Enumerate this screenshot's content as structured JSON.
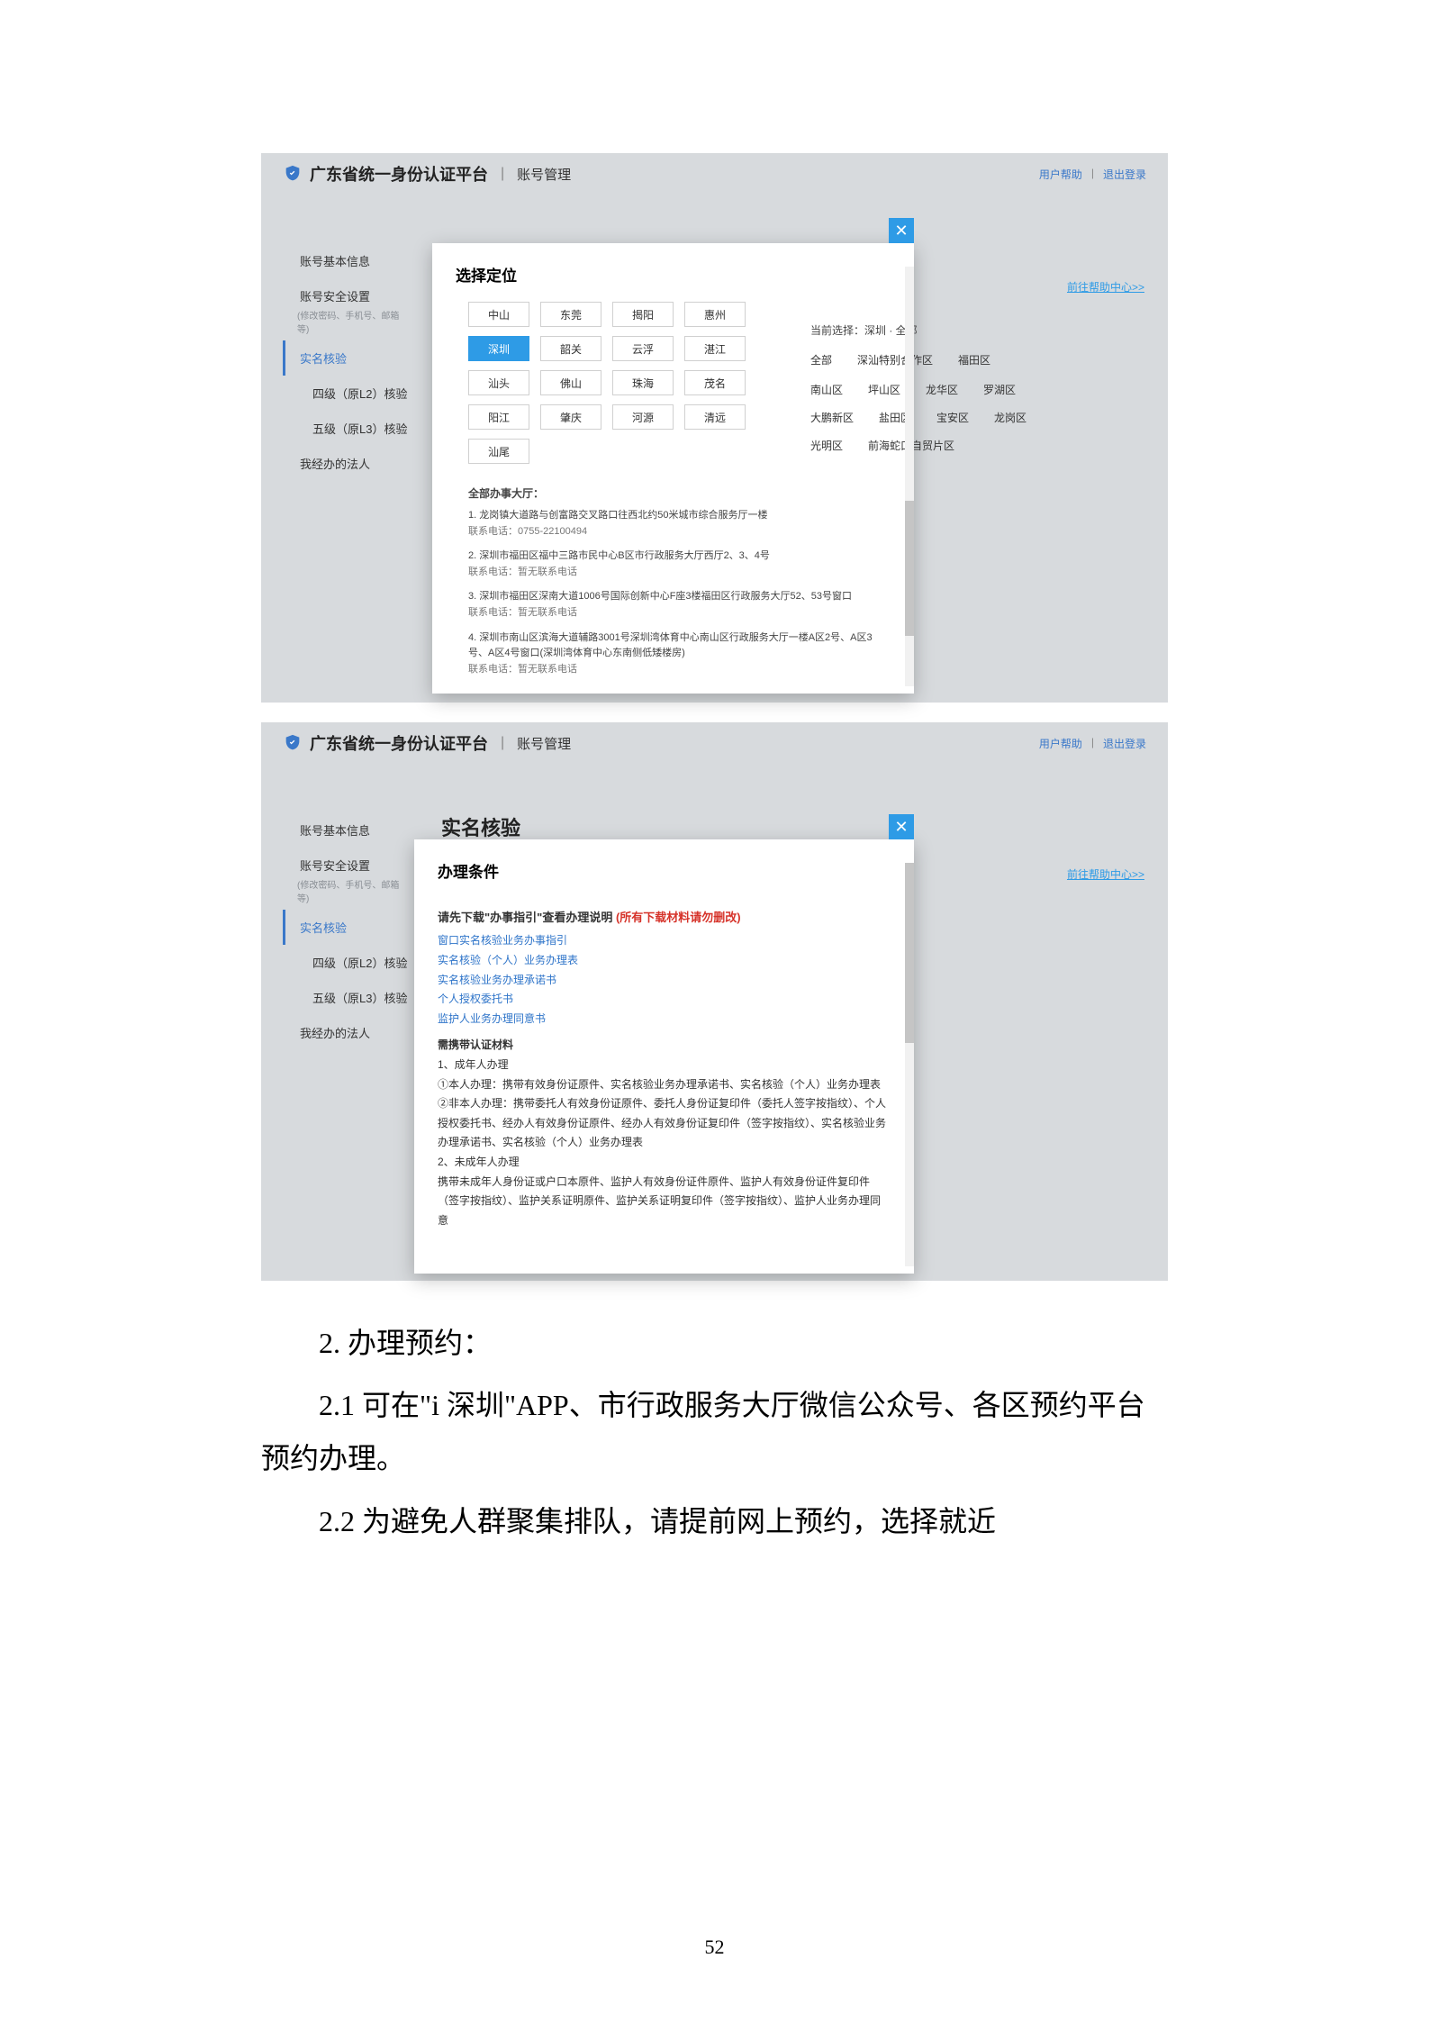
{
  "platform": {
    "title": "广东省统一身份认证平台",
    "section": "账号管理",
    "help": "用户帮助",
    "logout": "退出登录"
  },
  "sidebar": {
    "items": [
      {
        "label": "账号基本信息"
      },
      {
        "label": "账号安全设置",
        "hint": "(修改密码、手机号、邮箱等)"
      },
      {
        "label": "实名核验",
        "active": true
      },
      {
        "label": "四级（原L2）核验",
        "sub": true
      },
      {
        "label": "五级（原L3）核验",
        "sub": true
      },
      {
        "label": "我经办的法人"
      }
    ]
  },
  "help_center": "前往帮助中心>>",
  "modal1": {
    "title": "选择定位",
    "cities_rows": [
      [
        "中山",
        "东莞",
        "揭阳",
        "惠州",
        "深圳",
        "韶关"
      ],
      [
        "云浮",
        "湛江",
        "汕头",
        "佛山"
      ],
      [
        "珠海",
        "茂名",
        "阳江",
        "肇庆"
      ],
      [
        "河源",
        "清远",
        "汕尾"
      ]
    ],
    "selected_city": "深圳",
    "current_label": "当前选择：",
    "current_value": "深圳 · 全部",
    "districts_header": [
      "全部",
      "深汕特别合作区",
      "福田区"
    ],
    "districts": [
      "南山区",
      "坪山区",
      "龙华区",
      "罗湖区",
      "大鹏新区",
      "盐田区",
      "宝安区",
      "龙岗区",
      "光明区",
      "前海蛇口自贸片区"
    ],
    "hall_title": "全部办事大厅：",
    "halls": [
      {
        "addr": "1. 龙岗镇大道路与创富路交叉路口往西北约50米城市综合服务厅一楼",
        "tel": "联系电话：0755-22100494"
      },
      {
        "addr": "2. 深圳市福田区福中三路市民中心B区市行政服务大厅西厅2、3、4号",
        "tel": "联系电话：暂无联系电话"
      },
      {
        "addr": "3. 深圳市福田区深南大道1006号国际创新中心F座3楼福田区行政服务大厅52、53号窗口",
        "tel": "联系电话：暂无联系电话"
      },
      {
        "addr": "4. 深圳市南山区滨海大道辅路3001号深圳湾体育中心南山区行政服务大厅一楼A区2号、A区3号、A区4号窗口(深圳湾体育中心东南侧低矮楼房)",
        "tel": "联系电话：暂无联系电话"
      }
    ]
  },
  "modal2": {
    "ghost": "实名核验",
    "title": "办理条件",
    "lead": "请先下载\"办事指引\"查看办理说明",
    "lead_red": "(所有下载材料请勿删改)",
    "downloads": [
      "窗口实名核验业务办事指引",
      "实名核验（个人）业务办理表",
      "实名核验业务办理承诺书",
      "个人授权委托书",
      "监护人业务办理同意书"
    ],
    "mat_title": "需携带认证材料",
    "mat_1": "1、成年人办理",
    "mat_1a": "①本人办理：携带有效身份证原件、实名核验业务办理承诺书、实名核验（个人）业务办理表",
    "mat_1b": "②非本人办理：携带委托人有效身份证原件、委托人身份证复印件（委托人签字按指纹）、个人授权委托书、经办人有效身份证原件、经办人有效身份证复印件（签字按指纹）、实名核验业务办理承诺书、实名核验（个人）业务办理表",
    "mat_2": "2、未成年人办理",
    "mat_2a": "携带未成年人身份证或户口本原件、监护人有效身份证件原件、监护人有效身份证件复印件（签字按指纹）、监护关系证明原件、监护关系证明复印件（签字按指纹）、监护人业务办理同意"
  },
  "doc": {
    "h": "2. 办理预约：",
    "p1": "2.1 可在\"i 深圳\"APP、市行政服务大厅微信公众号、各区预约平台预约办理。",
    "p2": "2.2 为避免人群聚集排队，请提前网上预约，选择就近",
    "page": "52"
  }
}
